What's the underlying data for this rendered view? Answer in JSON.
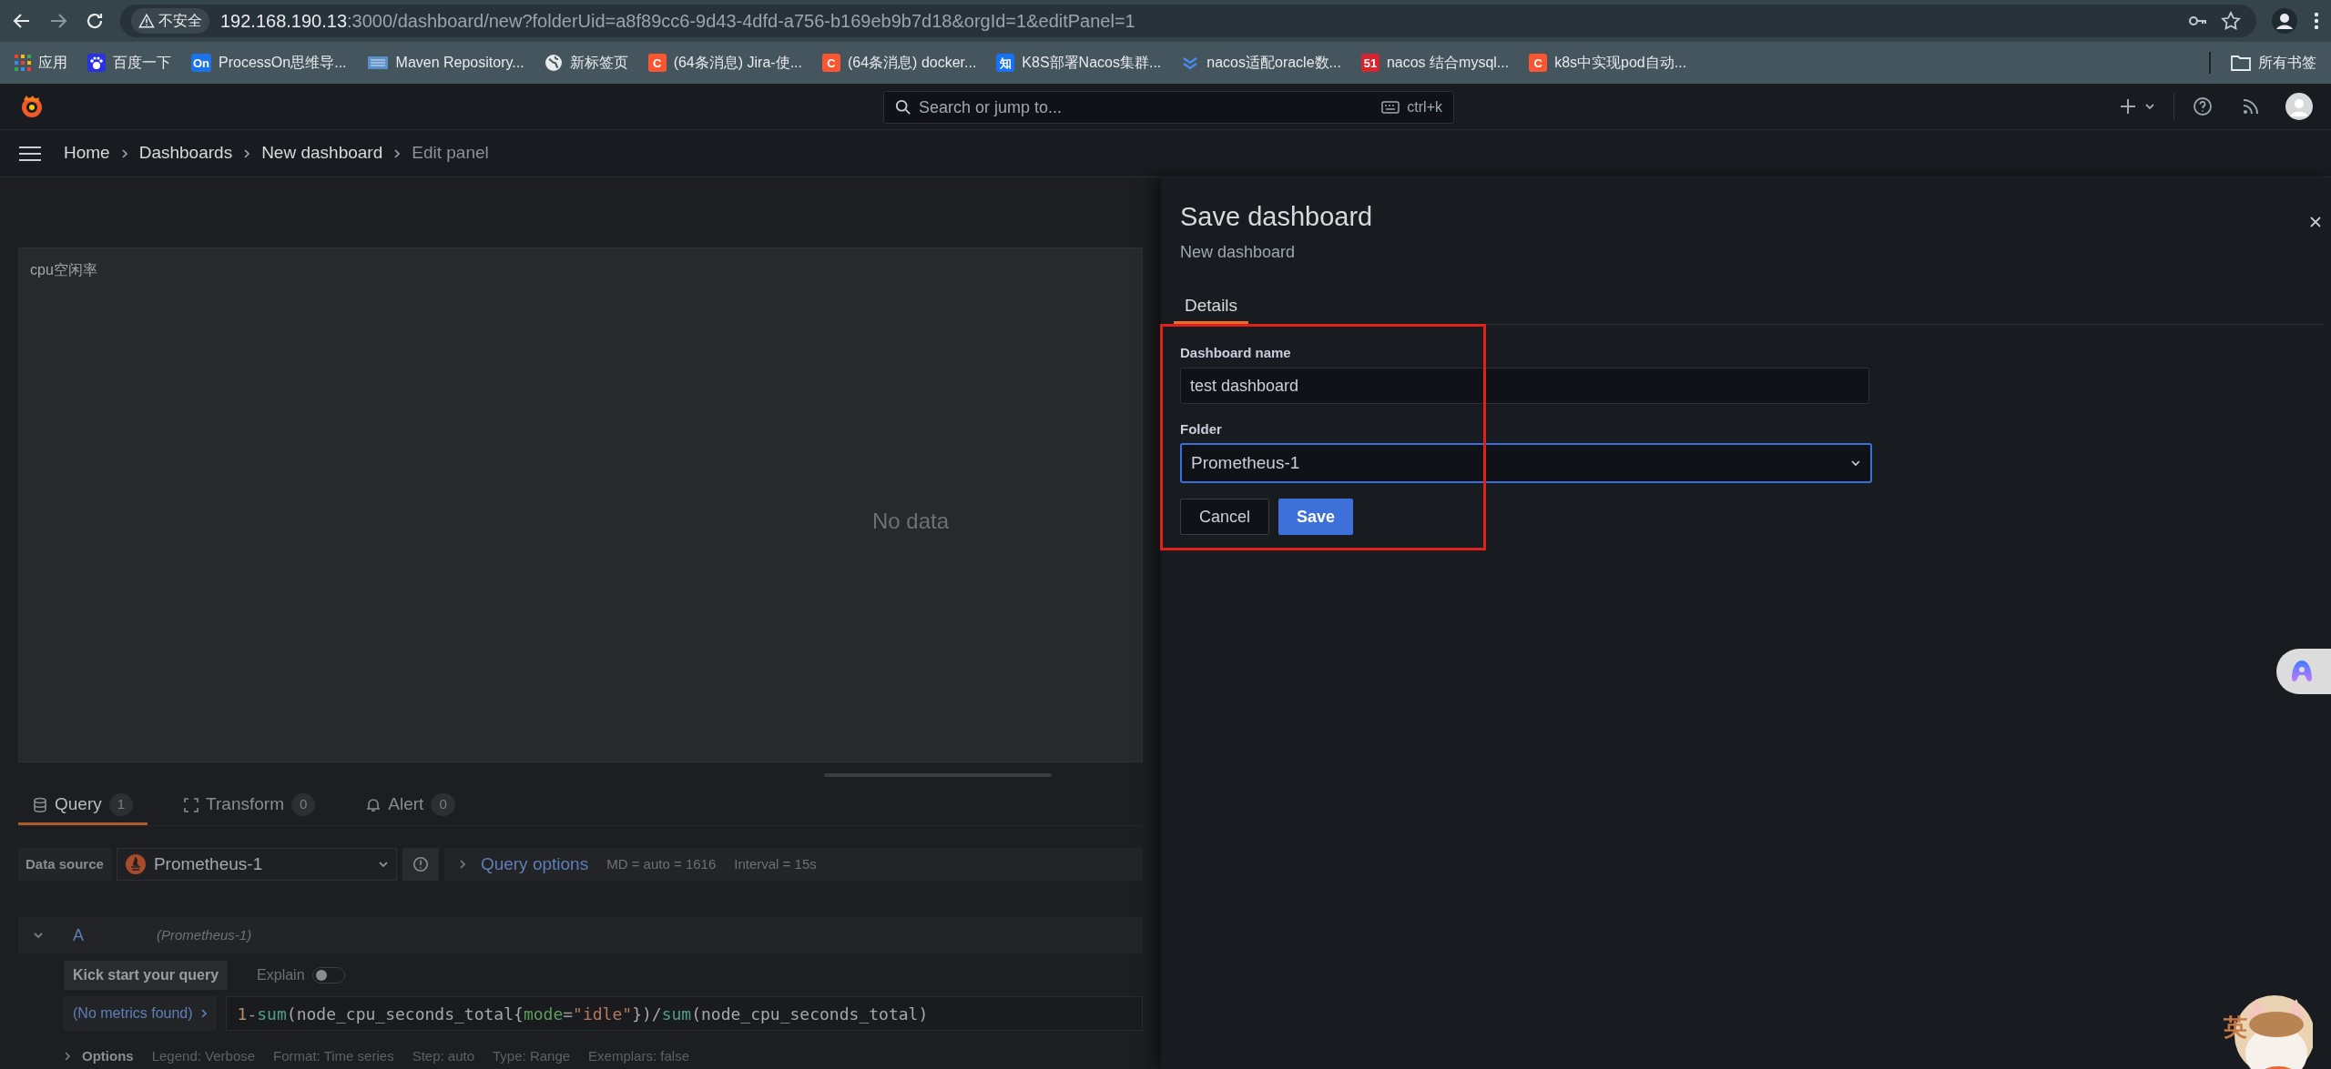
{
  "browser": {
    "security_label": "不安全",
    "url_host": "192.168.190.13",
    "url_rest": ":3000/dashboard/new?folderUid=a8f89cc6-9d43-4dfd-a756-b169eb9b7d18&orgId=1&editPanel=1",
    "bookmarks": [
      {
        "kind": "apps",
        "label": "应用"
      },
      {
        "kind": "paw",
        "label": "百度一下"
      },
      {
        "kind": "badge",
        "badge": "On",
        "color": "#1a73e8",
        "label": "ProcessOn思维导..."
      },
      {
        "kind": "maven",
        "label": "Maven Repository..."
      },
      {
        "kind": "globe",
        "label": "新标签页"
      },
      {
        "kind": "badge",
        "badge": "C",
        "color": "#fc5531",
        "label": "(64条消息) Jira-使..."
      },
      {
        "kind": "badge",
        "badge": "C",
        "color": "#fc5531",
        "label": "(64条消息) docker..."
      },
      {
        "kind": "badge",
        "badge": "知",
        "color": "#1772f6",
        "label": "K8S部署Nacos集群..."
      },
      {
        "kind": "chevrons",
        "label": "nacos适配oracle数..."
      },
      {
        "kind": "badge",
        "badge": "51",
        "color": "#d9232d",
        "label": "nacos 结合mysql..."
      },
      {
        "kind": "badge",
        "badge": "C",
        "color": "#fc5531",
        "label": "k8s中实现pod自动..."
      }
    ],
    "all_bookmarks": "所有书签"
  },
  "topbar": {
    "search_placeholder": "Search or jump to...",
    "shortcut": "ctrl+k"
  },
  "breadcrumbs": [
    {
      "label": "Home",
      "current": false
    },
    {
      "label": "Dashboards",
      "current": false
    },
    {
      "label": "New dashboard",
      "current": false
    },
    {
      "label": "Edit panel",
      "current": true
    }
  ],
  "panel": {
    "title": "cpu空闲率",
    "empty_text": "No data"
  },
  "query_tabs": [
    {
      "label": "Query",
      "count": "1",
      "selected": true
    },
    {
      "label": "Transform",
      "count": "0",
      "selected": false
    },
    {
      "label": "Alert",
      "count": "0",
      "selected": false
    }
  ],
  "datasource": {
    "label": "Data source",
    "value": "Prometheus-1",
    "query_options": "Query options",
    "md": "MD = auto = 1616",
    "interval": "Interval = 15s"
  },
  "query": {
    "ref": "A",
    "source": "(Prometheus-1)",
    "kick_start": "Kick start your query",
    "explain": {
      "label": "Explain",
      "on": false
    },
    "metrics": "(No metrics found)",
    "code": [
      {
        "kind": "number",
        "text": "1"
      },
      {
        "kind": "op",
        "text": "-"
      },
      {
        "kind": "func",
        "text": "sum"
      },
      {
        "kind": "plain",
        "text": "(node_cpu_seconds_total{"
      },
      {
        "kind": "label",
        "text": "mode"
      },
      {
        "kind": "op",
        "text": "="
      },
      {
        "kind": "string",
        "text": "\"idle\""
      },
      {
        "kind": "plain",
        "text": "})/"
      },
      {
        "kind": "func",
        "text": "sum"
      },
      {
        "kind": "plain",
        "text": "(node_cpu_seconds_total)"
      }
    ],
    "options_label": "Options",
    "options": [
      "Legend: Verbose",
      "Format: Time series",
      "Step: auto",
      "Type: Range",
      "Exemplars: false"
    ]
  },
  "drawer": {
    "title": "Save dashboard",
    "subtitle": "New dashboard",
    "tabs": [
      {
        "label": "Details",
        "selected": true
      }
    ],
    "name_label": "Dashboard name",
    "name_value": "test dashboard",
    "folder_label": "Folder",
    "folder_value": "Prometheus-1",
    "cancel": "Cancel",
    "save": "Save"
  },
  "ime_indicator": "英"
}
